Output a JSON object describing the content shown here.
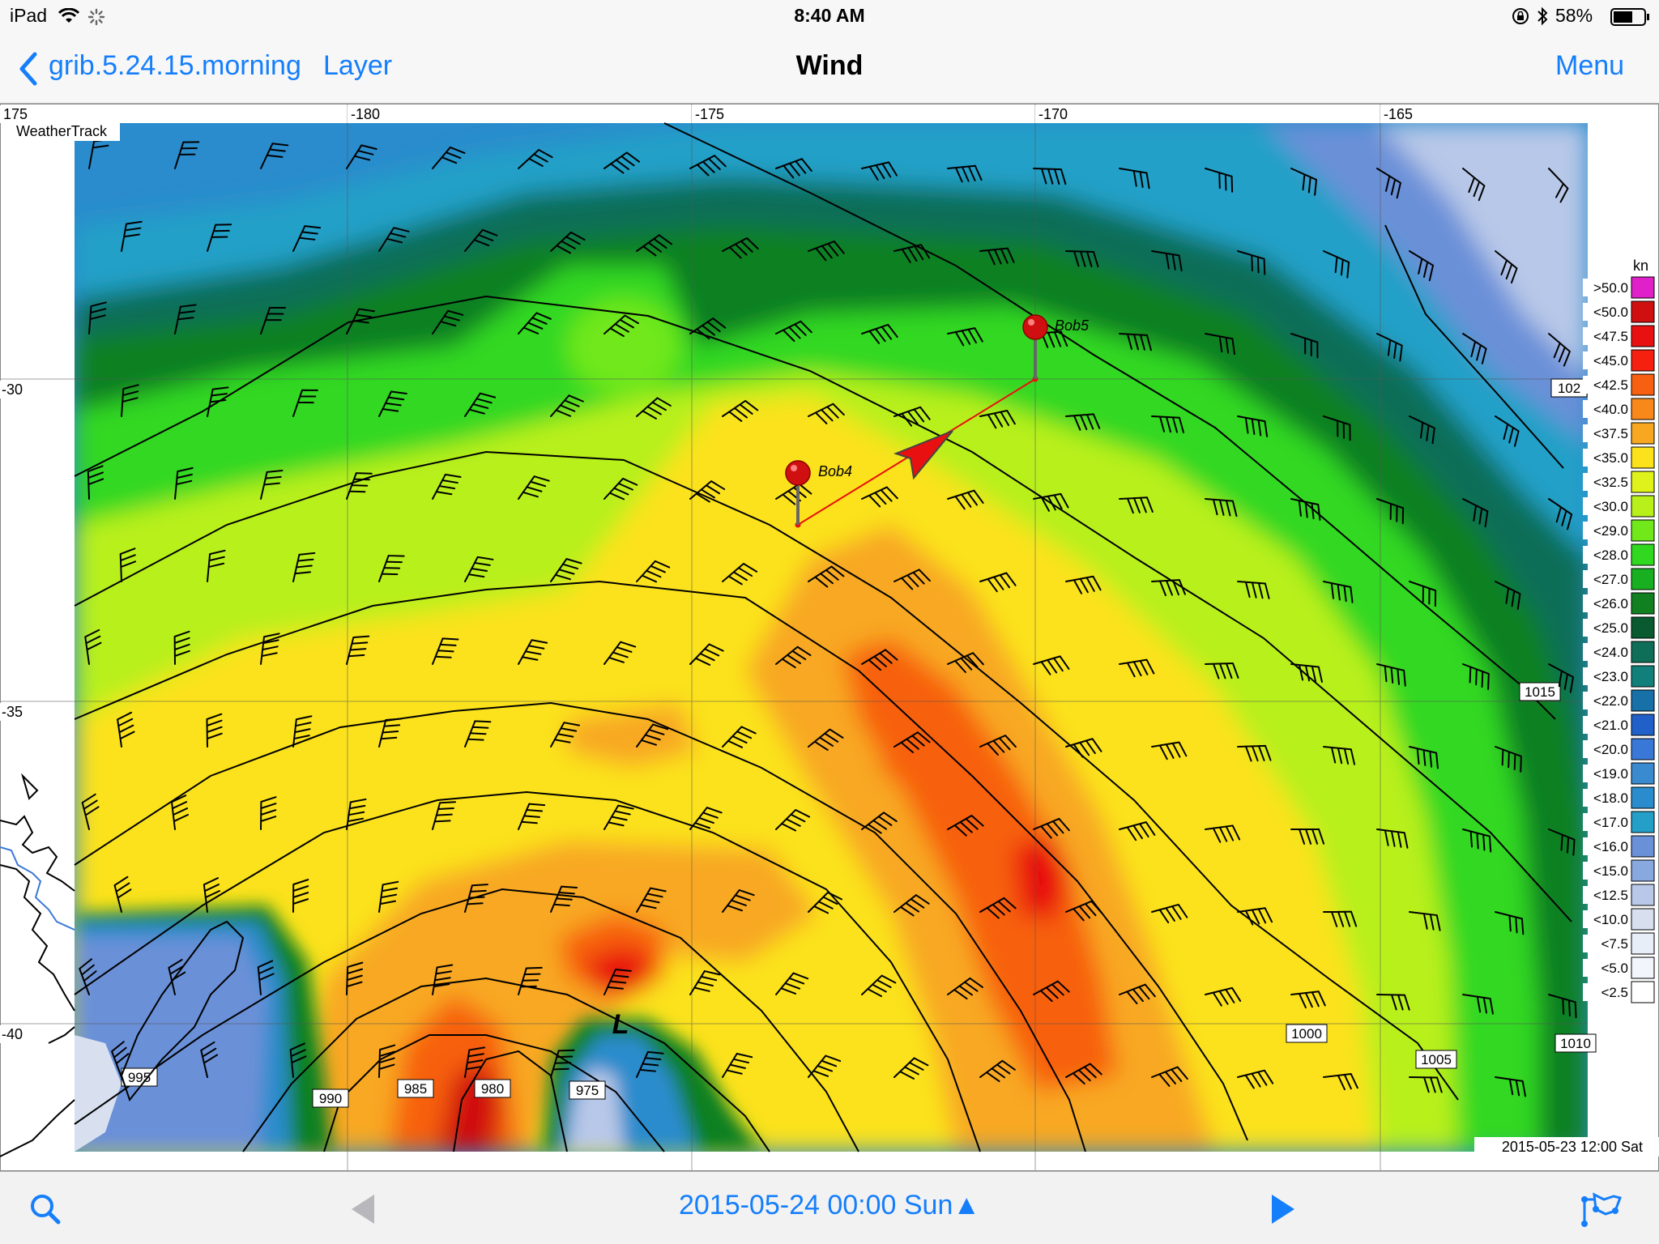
{
  "status": {
    "device": "iPad",
    "time": "8:40 AM",
    "battery": "58%"
  },
  "nav": {
    "back_label": "grib.5.24.15.morning",
    "layer_label": "Layer",
    "title": "Wind",
    "menu_label": "Menu"
  },
  "map": {
    "brand": "WeatherTrack",
    "lon_labels": [
      "175",
      "-180",
      "-175",
      "-170",
      "-165"
    ],
    "lat_labels": [
      "-30",
      "-35",
      "-40"
    ],
    "isobar_labels": [
      "995",
      "990",
      "985",
      "980",
      "975",
      "1000",
      "1005",
      "1010",
      "1015",
      "102"
    ],
    "low_marker": "L",
    "waypoints": [
      "Bob4",
      "Bob5"
    ],
    "data_timestamp": "2015-05-23 12:00 Sat"
  },
  "legend": {
    "unit": "kn",
    "items": [
      {
        "label": ">50.0",
        "color": "#e020c8"
      },
      {
        "label": "<50.0",
        "color": "#d01010"
      },
      {
        "label": "<47.5",
        "color": "#e81010"
      },
      {
        "label": "<45.0",
        "color": "#f52010"
      },
      {
        "label": "<42.5",
        "color": "#f76010"
      },
      {
        "label": "<40.0",
        "color": "#f8881a"
      },
      {
        "label": "<37.5",
        "color": "#f8a820"
      },
      {
        "label": "<35.0",
        "color": "#fbe21a"
      },
      {
        "label": "<32.5",
        "color": "#dff21a"
      },
      {
        "label": "<30.0",
        "color": "#b8f01a"
      },
      {
        "label": "<29.0",
        "color": "#70e81a"
      },
      {
        "label": "<28.0",
        "color": "#30d820"
      },
      {
        "label": "<27.0",
        "color": "#18b020"
      },
      {
        "label": "<26.0",
        "color": "#108020"
      },
      {
        "label": "<25.0",
        "color": "#0a5a30"
      },
      {
        "label": "<24.0",
        "color": "#0e6e58"
      },
      {
        "label": "<23.0",
        "color": "#12807a"
      },
      {
        "label": "<22.0",
        "color": "#1870a8"
      },
      {
        "label": "<21.0",
        "color": "#2060c8"
      },
      {
        "label": "<20.0",
        "color": "#3a78d8"
      },
      {
        "label": "<19.0",
        "color": "#3a8ad0"
      },
      {
        "label": "<18.0",
        "color": "#2a8ccc"
      },
      {
        "label": "<17.0",
        "color": "#24a0c8"
      },
      {
        "label": "<16.0",
        "color": "#6a90d8"
      },
      {
        "label": "<15.0",
        "color": "#88a8e0"
      },
      {
        "label": "<12.5",
        "color": "#b8c8e8"
      },
      {
        "label": "<10.0",
        "color": "#d8e0f0"
      },
      {
        "label": "<7.5",
        "color": "#e8eef8"
      },
      {
        "label": "<5.0",
        "color": "#f2f5fb"
      },
      {
        "label": "<2.5",
        "color": "#ffffff"
      }
    ]
  },
  "toolbar": {
    "date": "2015-05-24 00:00 Sun▲"
  }
}
